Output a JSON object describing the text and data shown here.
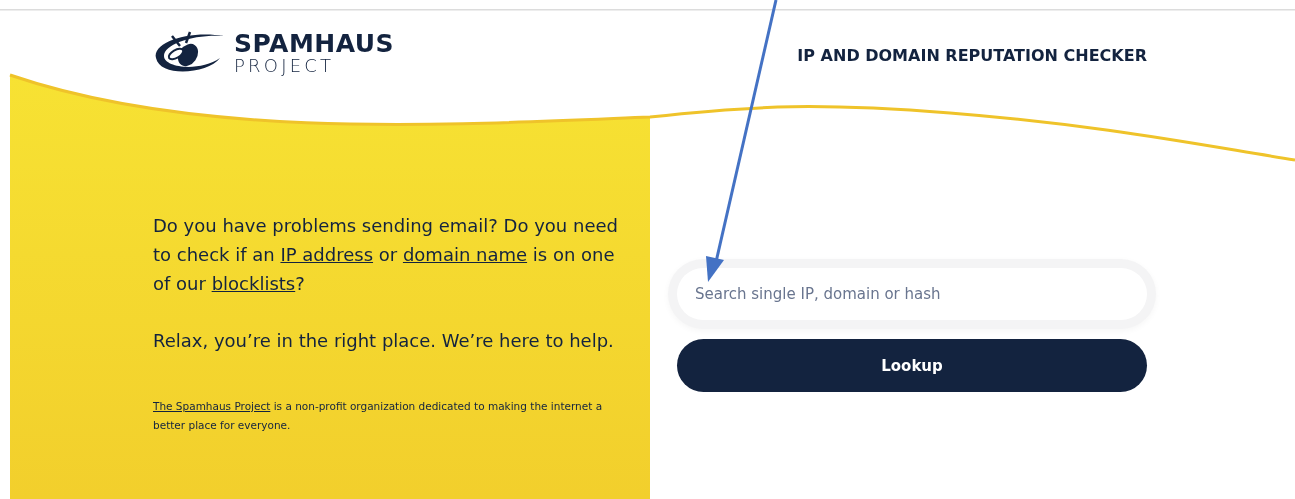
{
  "header": {
    "logo": {
      "name": "SPAMHAUS",
      "subtitle": "PROJECT"
    },
    "title": "IP AND DOMAIN REPUTATION CHECKER"
  },
  "intro": [
    [
      {
        "kind": "text",
        "text": "Do you have problems sending email? Do you need to check if an "
      },
      {
        "kind": "link",
        "text": "IP address"
      },
      {
        "kind": "text",
        "text": " or "
      },
      {
        "kind": "link",
        "text": "domain name"
      },
      {
        "kind": "text",
        "text": " is on one of our "
      },
      {
        "kind": "link",
        "text": "blocklists"
      },
      {
        "kind": "text",
        "text": "?"
      }
    ],
    [
      {
        "kind": "text",
        "text": "Relax, you’re in the right place. We’re here to help."
      }
    ]
  ],
  "note": [
    {
      "kind": "link",
      "text": "The Spamhaus Project"
    },
    {
      "kind": "text",
      "text": " is a non-profit organization dedicated to making the internet a better place for everyone."
    }
  ],
  "search": {
    "placeholder": "Search single IP, domain or hash"
  },
  "lookup_button": "Lookup"
}
